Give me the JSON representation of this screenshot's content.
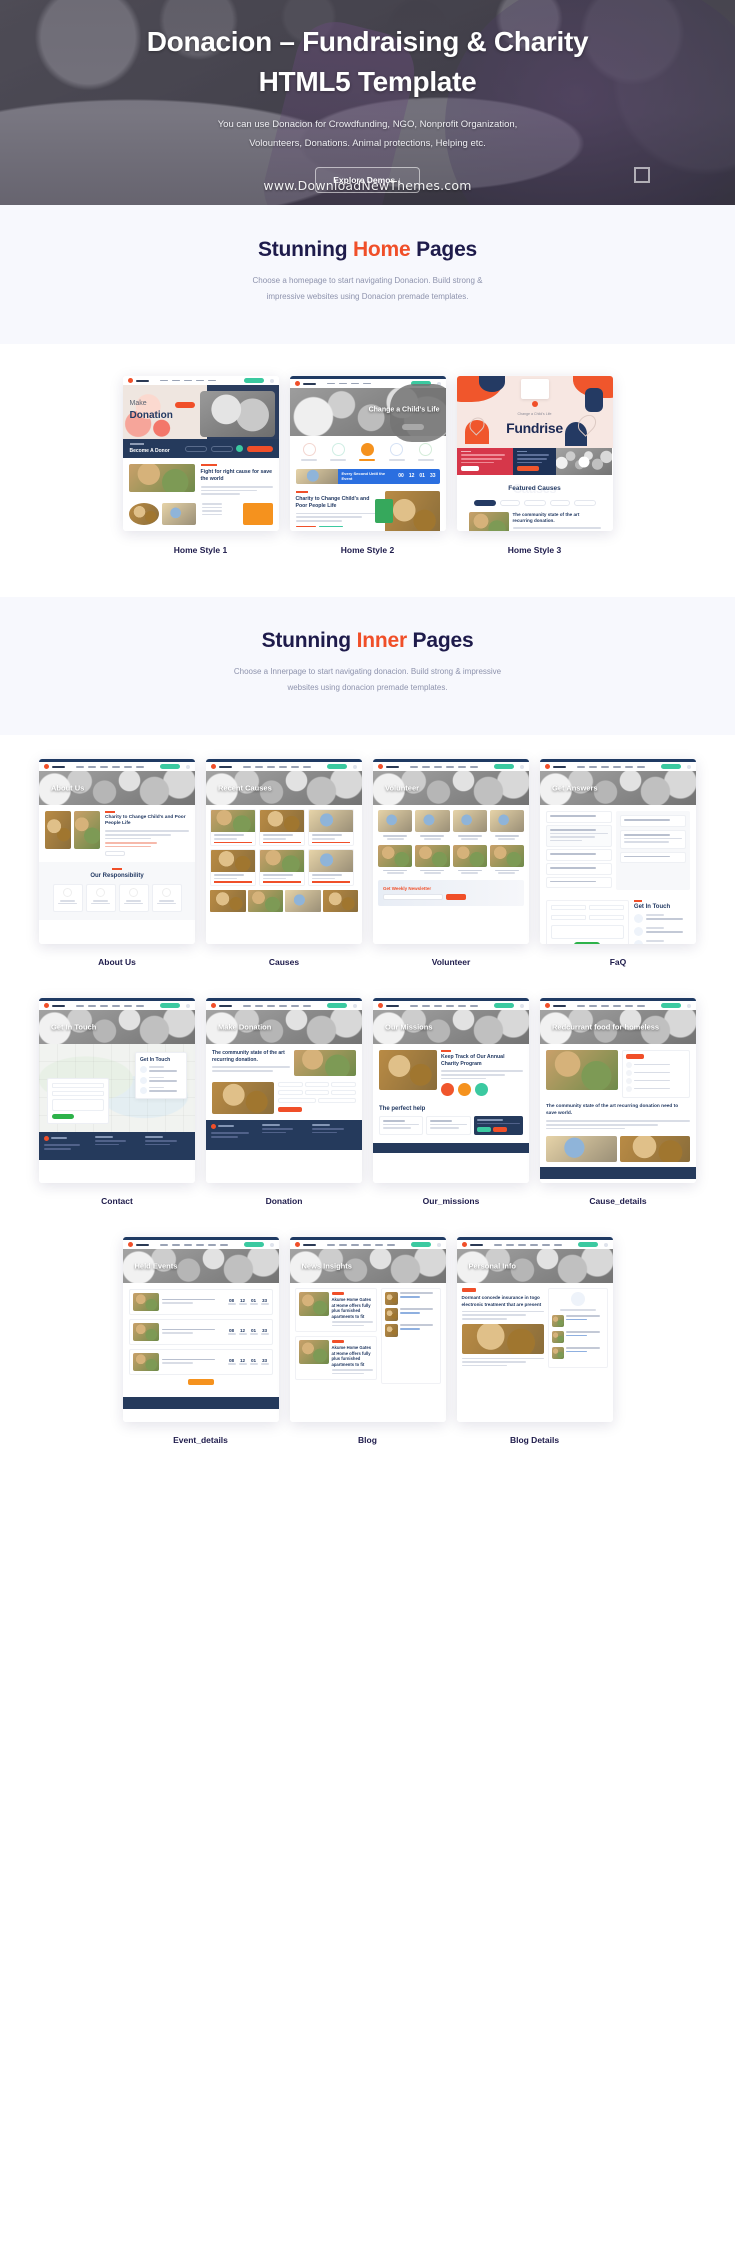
{
  "hero": {
    "title_line1": "Donacion – Fundraising & Charity",
    "title_line2": "HTML5 Template",
    "subtitle_line1": "You can use Donacion for Crowdfunding, NGO, Nonprofit Organization,",
    "subtitle_line2": "Volounteers, Donations. Animal protections, Helping etc.",
    "cta_label": "Explore Demos ↓",
    "watermark": "www.DownloadNewThemes.com"
  },
  "colors": {
    "accent": "#f04f29",
    "dark": "#1e1b4b",
    "navy": "#253a5c",
    "teal": "#3bc9a0",
    "band": "#f7f8fd",
    "muted": "#8e93ad"
  },
  "home_section": {
    "title_pre": "Stunning ",
    "title_accent": "Home",
    "title_post": " Pages",
    "desc_line1": "Choose a homepage to start navigating Donacion. Build strong &",
    "desc_line2": "impressive websites using Donacion premade templates.",
    "cards": [
      {
        "label": "Home Style 1",
        "hero_text": "Donation",
        "hero_kicker": "Make",
        "band_text": "Become A Donor",
        "body_title": "Fight for right cause for save the world"
      },
      {
        "label": "Home Style 2",
        "hero_text": "Change a Child's Life",
        "body_title": "Charity to Change Child's and Poor People Life"
      },
      {
        "label": "Home Style 3",
        "hero_text": "Fundrise",
        "body_title": "Featured Causes"
      }
    ]
  },
  "inner_section": {
    "title_pre": "Stunning ",
    "title_accent": "Inner",
    "title_post": " Pages",
    "desc_line1": "Choose a Innerpage to start navigating donacion. Build strong & impressive",
    "desc_line2": "websites using donacion premade templates.",
    "cards": [
      {
        "label": "About Us",
        "banner": "About Us",
        "body_title": "Charity to Change Child's and Poor People Life",
        "section_title": "Our Responsibility"
      },
      {
        "label": "Causes",
        "banner": "Recent Causes",
        "body_title": "",
        "section_title": ""
      },
      {
        "label": "Volunteer",
        "banner": "Volunteer",
        "body_title": "",
        "section_title": ""
      },
      {
        "label": "FaQ",
        "banner": "Get Answers",
        "body_title": "",
        "section_title": "Get In Touch"
      },
      {
        "label": "Contact",
        "banner": "Get In Touch",
        "body_title": "",
        "section_title": "Get In Touch"
      },
      {
        "label": "Donation",
        "banner": "Make Donation",
        "body_title": "The community state of the art recurring donation.",
        "section_title": ""
      },
      {
        "label": "Our_missions",
        "banner": "Our Missions",
        "body_title": "Keep Track of Our Annual Charity Program",
        "section_title": "The perfect help"
      },
      {
        "label": "Cause_details",
        "banner": "Redcurrant food for homeless",
        "body_title": "The community state of the art recurring donation need to save world.",
        "section_title": ""
      },
      {
        "label": "Event_details",
        "banner": "Held Events",
        "body_title": "",
        "section_title": ""
      },
      {
        "label": "Blog",
        "banner": "News Insights",
        "body_title": "Akume Home Gates at Home offers fully plus furnished apartments to fit",
        "section_title": ""
      },
      {
        "label": "Blog Details",
        "banner": "Personal Info",
        "body_title": "Dormant concede insurance in togo electronic treatment that are present",
        "section_title": ""
      }
    ]
  }
}
